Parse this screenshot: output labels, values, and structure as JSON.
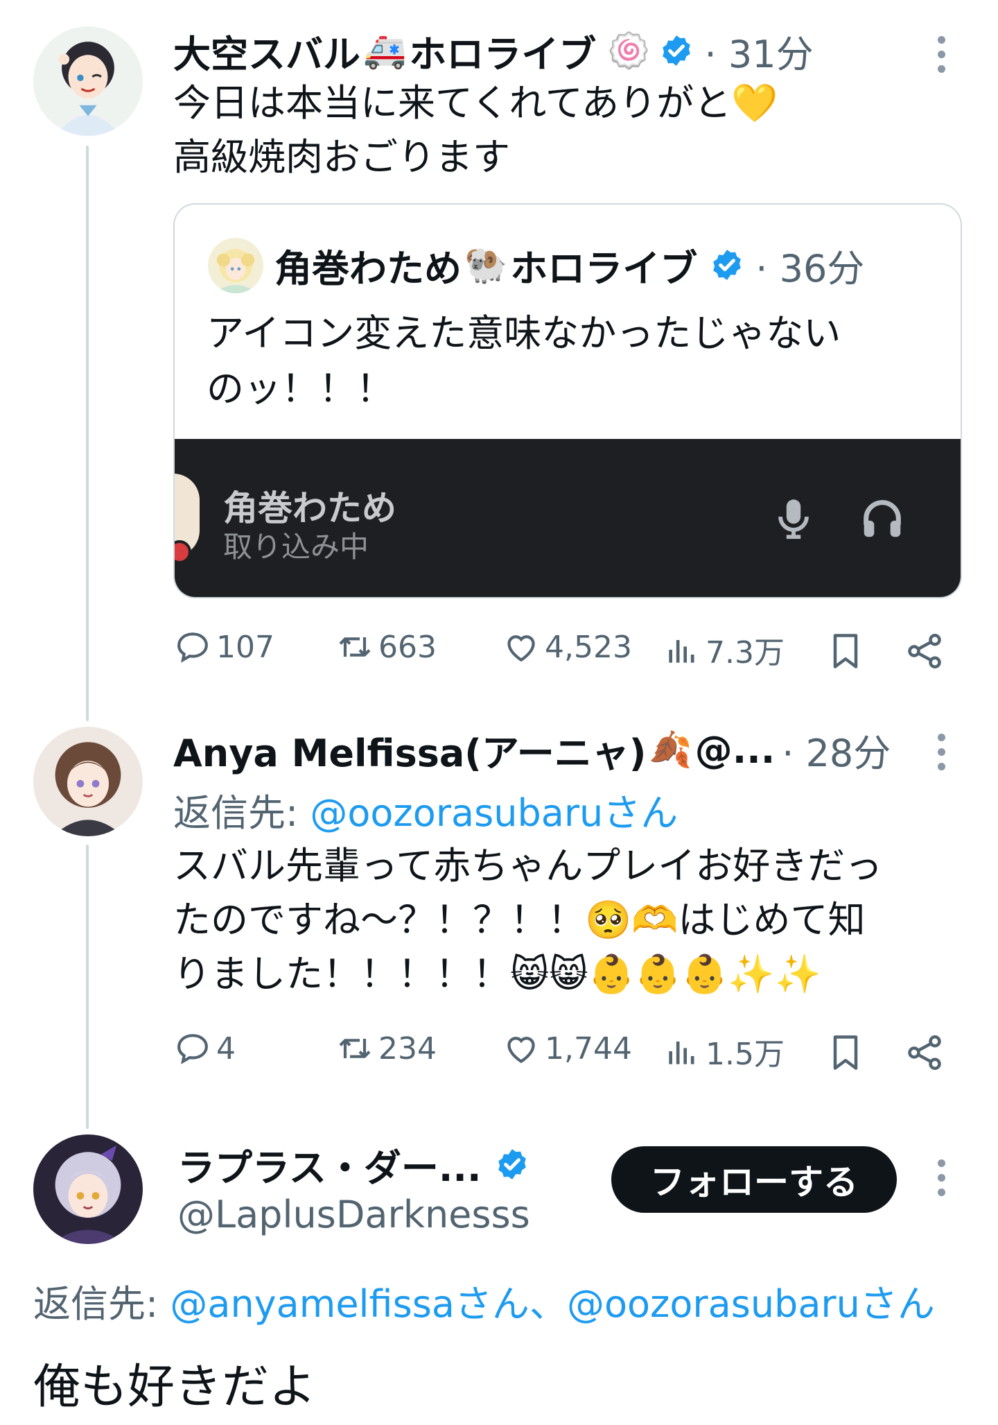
{
  "tweet1": {
    "name": "大空スバル",
    "emoji1": "🚑",
    "name_suffix": "ホロライブ",
    "emoji2": "🍥",
    "time": "· 31分",
    "line1": "今日は本当に来てくれてありがと",
    "line1_emoji": "💛",
    "line2": "高級焼肉おごります",
    "quote": {
      "name": "角巻わため",
      "emoji": "🐏",
      "name_suffix": "ホロライブ",
      "time": "· 36分",
      "line1": "アイコン変えた意味なかったじゃない",
      "line2": "のッ！！！",
      "media_name": "角巻わため",
      "media_status": "取り込み中"
    },
    "stats": {
      "replies": "107",
      "retweets": "663",
      "likes": "4,523",
      "views": "7.3万"
    }
  },
  "tweet2": {
    "name": "Anya Melfissa(アーニャ)",
    "emoji": "🍂",
    "name_suffix": "@...",
    "time": "· 28分",
    "reply_label": "返信先: ",
    "reply_mention": "@oozorasubaruさん",
    "line1": "スバル先輩って赤ちゃんプレイお好きだっ",
    "line2": "たのですね〜？！？！！",
    "line2_emoji": "🥺🫶",
    "line2_end": "はじめて知",
    "line3": "りました！！！！！",
    "line3_emoji": "😸😸👶👶👶✨✨",
    "stats": {
      "replies": "4",
      "retweets": "234",
      "likes": "1,744",
      "views": "1.5万"
    }
  },
  "tweet3": {
    "name": "ラプラス・ダー...",
    "handle": "@LaplusDarknesss",
    "follow_label": "フォローする",
    "reply_label": "返信先: ",
    "reply_mention1": "@anyamelfissaさん",
    "reply_sep": "、",
    "reply_mention2": "@oozorasubaruさん",
    "text": "俺も好きだよ"
  },
  "colors": {
    "accent": "#1d9bf0",
    "muted": "#536471",
    "text": "#0f1419"
  },
  "icons": [
    "reply-icon",
    "retweet-icon",
    "like-icon",
    "views-icon",
    "bookmark-icon",
    "share-icon",
    "verified-icon",
    "more-icon",
    "mic-icon",
    "headphones-icon"
  ]
}
